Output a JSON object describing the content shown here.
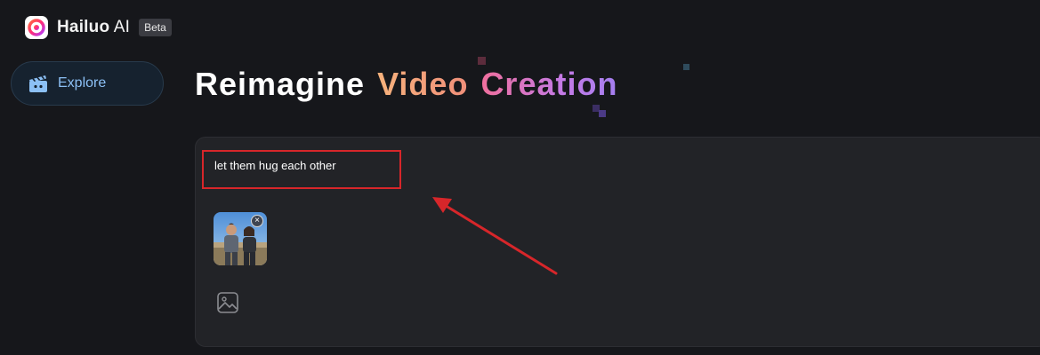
{
  "header": {
    "app_name_main": "Hailuo",
    "app_name_suffix": " AI",
    "badge": "Beta"
  },
  "sidebar": {
    "items": [
      {
        "label": "Explore",
        "icon": "clapperboard-icon",
        "color": "#8cc0f5"
      }
    ]
  },
  "hero": {
    "word1": "Reimagine",
    "word2": "Video",
    "word3": "Creation"
  },
  "prompt": {
    "text": "let them hug each other",
    "attachment_icon": "image-upload-icon"
  },
  "annotation": {
    "highlight_color": "#d7262a",
    "arrow_color": "#d7262a"
  }
}
